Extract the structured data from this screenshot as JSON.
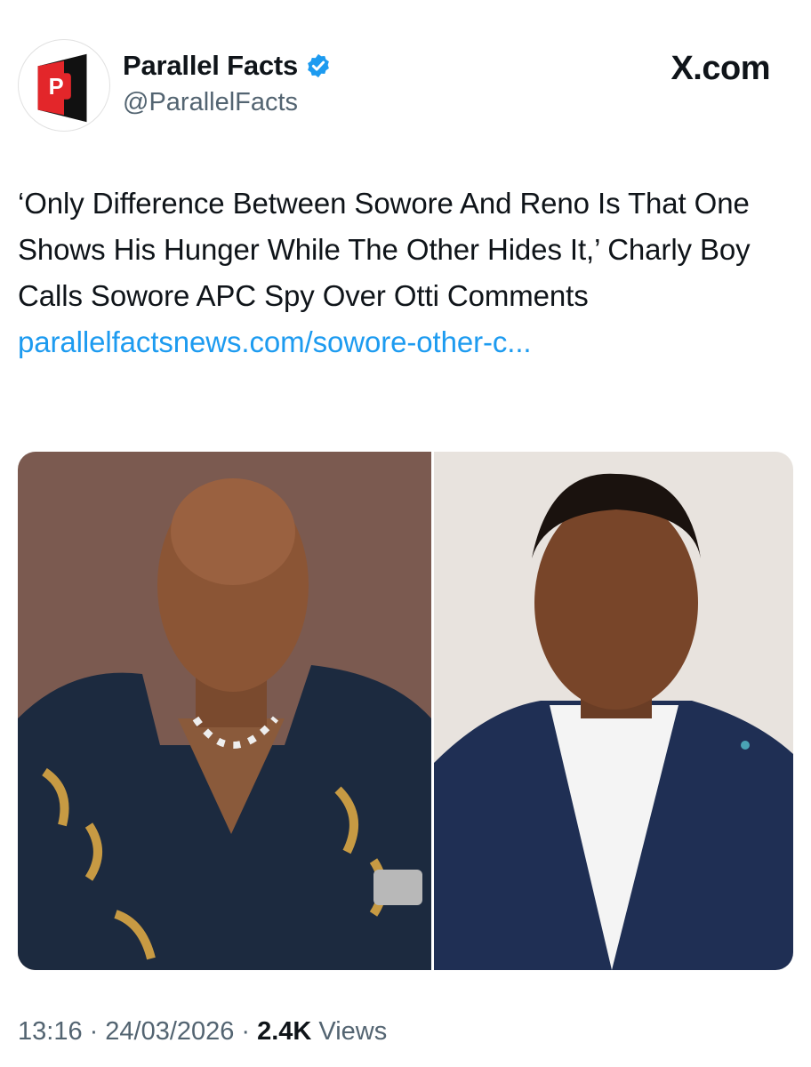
{
  "account": {
    "display_name": "Parallel Facts",
    "handle": "@ParallelFacts",
    "avatar_letter": "P",
    "verified_color": "#1d9bf0"
  },
  "brand": {
    "label": "X.com"
  },
  "tweet": {
    "text": "‘Only Difference Between Sowore And Reno Is That One Shows His Hunger While The Other Hides It,’ Charly Boy Calls Sowore APC Spy Over Otti Comments ",
    "link": "parallelfactsnews.com/sowore-other-c..."
  },
  "media": {
    "left_photo": "man-with-bald-head-in-patterned-shirt",
    "right_photo": "man-in-navy-suit-white-shirt"
  },
  "meta": {
    "time": "13:16",
    "separator1": "·",
    "date": "24/03/2026",
    "separator2": "·",
    "views_count": "2.4K",
    "views_label": "Views"
  },
  "colors": {
    "text": "#0f1419",
    "secondary": "#536471",
    "link": "#1d9bf0",
    "logo_red": "#e3262a",
    "logo_dark": "#111111"
  }
}
